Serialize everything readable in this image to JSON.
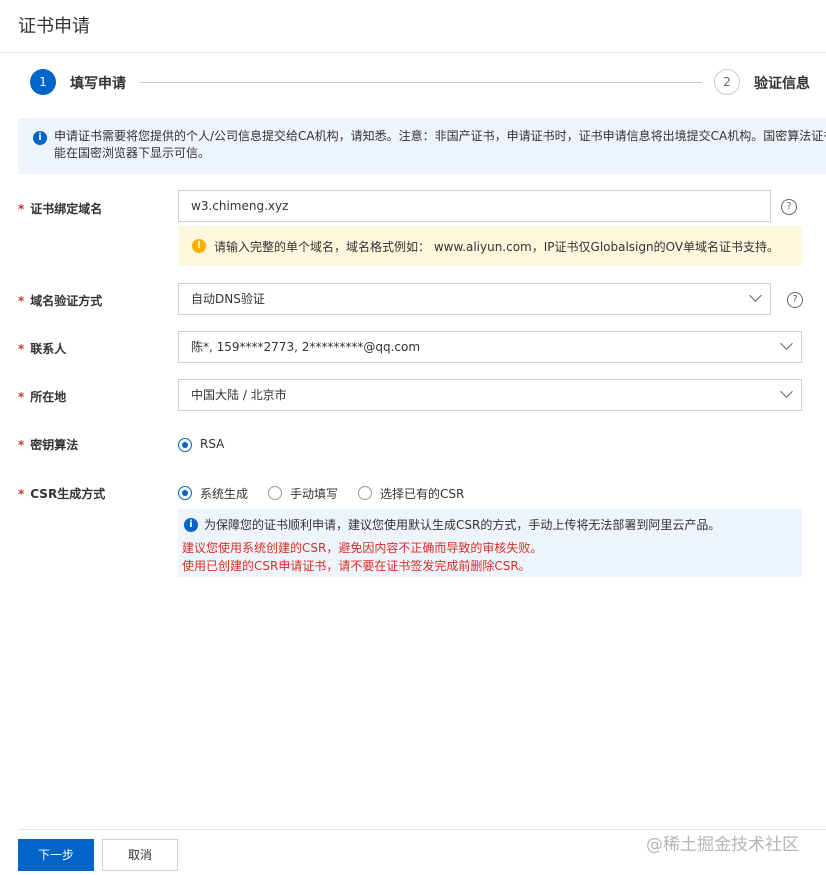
{
  "title": "证书申请",
  "steps": [
    {
      "number": "1",
      "label": "填写申请"
    },
    {
      "number": "2",
      "label": "验证信息"
    }
  ],
  "notice": "申请证书需要将您提供的个人/公司信息提交给CA机构，请知悉。注意：非国产证书，申请证书时，证书申请信息将出境提交CA机构。国密算法证书只能在国密浏览器下显示可信。",
  "form": {
    "domain": {
      "label": "证书绑定域名",
      "value": "w3.chimeng.xyz",
      "hint": "请输入完整的单个域名，域名格式例如： www.aliyun.com，IP证书仅Globalsign的OV单域名证书支持。"
    },
    "verify_method": {
      "label": "域名验证方式",
      "value": "自动DNS验证"
    },
    "contact": {
      "label": "联系人",
      "value": "陈*, 159****2773, 2*********@qq.com"
    },
    "location": {
      "label": "所在地",
      "value": "中国大陆 / 北京市"
    },
    "key_algorithm": {
      "label": "密钥算法",
      "options": [
        "RSA"
      ],
      "selected": "RSA"
    },
    "csr": {
      "label": "CSR生成方式",
      "options": [
        "系统生成",
        "手动填写",
        "选择已有的CSR"
      ],
      "selected": "系统生成",
      "info": "为保障您的证书顺利申请，建议您使用默认生成CSR的方式，手动上传将无法部署到阿里云产品。",
      "warning1": "建议您使用系统创建的CSR，避免因内容不正确而导致的审核失败。",
      "warning2": "使用已创建的CSR申请证书，请不要在证书签发完成前删除CSR。"
    }
  },
  "buttons": {
    "next": "下一步",
    "cancel": "取消"
  },
  "watermark": "@稀土掘金技术社区",
  "colors": {
    "primary": "#0064c8",
    "required": "#d93026",
    "info_bg": "#eef4fb",
    "warn_bg": "#fff7dd"
  }
}
